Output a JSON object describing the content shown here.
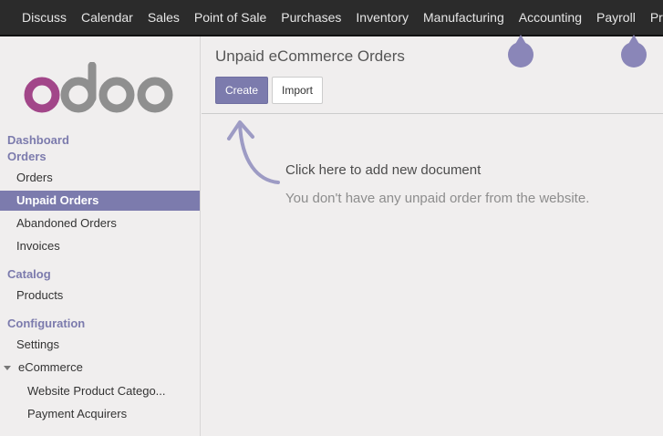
{
  "topbar": {
    "items": [
      "Discuss",
      "Calendar",
      "Sales",
      "Point of Sale",
      "Purchases",
      "Inventory",
      "Manufacturing",
      "Accounting",
      "Payroll",
      "Project"
    ]
  },
  "sidebar": {
    "sections": {
      "dashboard": "Dashboard",
      "orders": "Orders",
      "catalog": "Catalog",
      "configuration": "Configuration"
    },
    "items": {
      "orders": "Orders",
      "unpaid_orders": "Unpaid Orders",
      "abandoned_orders": "Abandoned Orders",
      "invoices": "Invoices",
      "products": "Products",
      "settings": "Settings",
      "ecommerce": "eCommerce",
      "website_product_categories": "Website Product Catego...",
      "payment_acquirers": "Payment Acquirers"
    }
  },
  "main": {
    "breadcrumb": "Unpaid eCommerce Orders",
    "create_label": "Create",
    "import_label": "Import",
    "help_title": "Click here to add new document",
    "help_text": "You don't have any unpaid order from the website."
  },
  "colors": {
    "brand": "#7c7bad",
    "topbar": "#2b2b2b"
  }
}
